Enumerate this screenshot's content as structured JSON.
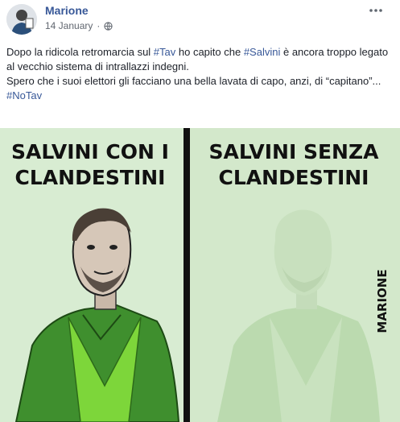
{
  "post": {
    "author": "Marione",
    "date": "14 January",
    "date_separator": "·",
    "audience_icon": "globe-icon",
    "more_icon": "more-options-icon",
    "text": {
      "line1_before": "Dopo la ridicola retromarcia sul ",
      "hashtag_tav": "#Tav",
      "line1_mid": " ho capito che ",
      "hashtag_salvini": "#Salvini",
      "line1_after": " è ancora troppo legato al vecchio sistema di intrallazzi indegni.",
      "line2": "Spero che i suoi elettori gli facciano una bella lavata di capo, anzi, di “capitano”...",
      "hashtag_notav": "#NoTav"
    }
  },
  "cartoon": {
    "left_caption_line1": "SALVINI CON I",
    "left_caption_line2": "CLANDESTINI",
    "right_caption_line1": "SALVINI SENZA",
    "right_caption_line2": "CLANDESTINI",
    "signature": "MARIONE",
    "colors": {
      "background": "#d8ecd2",
      "right_background": "#d3e8cb",
      "jacket": "#3f8f2e",
      "shirt": "#7dd63a",
      "faded_figure": "#b7d9a9"
    }
  }
}
